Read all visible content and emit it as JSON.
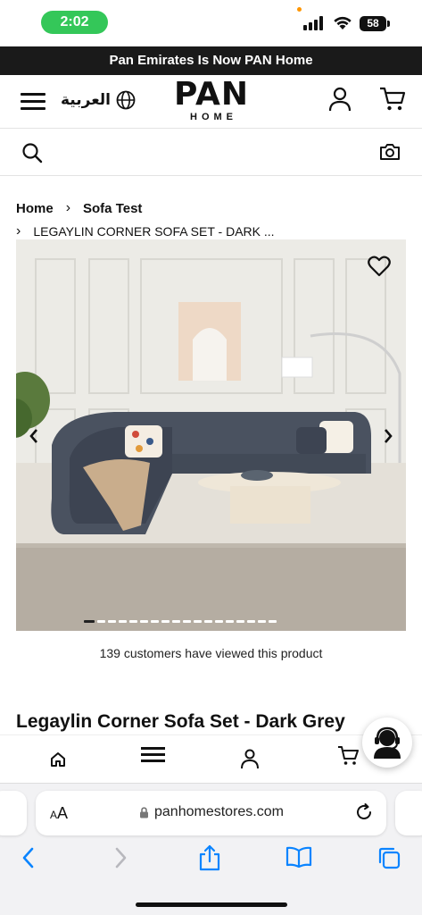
{
  "status_bar": {
    "time": "2:02",
    "battery": "58"
  },
  "announcement": "Pan Emirates Is Now PAN Home",
  "header": {
    "language": "العربية",
    "logo_main": "PAN",
    "logo_sub": "HOME"
  },
  "search": {
    "placeholder": ""
  },
  "breadcrumb": {
    "items": [
      "Home",
      "Sofa Test"
    ],
    "current": "LEGAYLIN CORNER SOFA SET - DARK ..."
  },
  "gallery": {
    "total_images": 18,
    "active_index": 0
  },
  "viewers_text": "139 customers have viewed this product",
  "product": {
    "title": "Legaylin Corner Sofa Set - Dark Grey"
  },
  "browser": {
    "aa_label": "AA",
    "url": "panhomestores.com"
  },
  "colors": {
    "announce_bg": "#1a1a1a",
    "status_green": "#34c759",
    "ios_blue": "#0a84ff"
  }
}
